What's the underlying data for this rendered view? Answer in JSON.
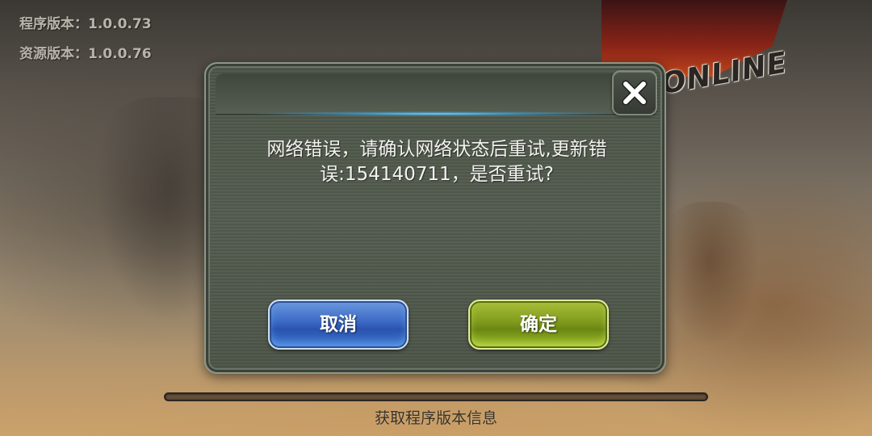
{
  "version_info": {
    "program_version": "程序版本：1.0.0.73",
    "resource_version": "资源版本：1.0.0.76"
  },
  "background": {
    "logo_text": "ONLINE"
  },
  "dialog": {
    "message": "网络错误，请确认网络状态后重试,更新错误:154140711，是否重试?",
    "close_icon": "close-icon",
    "cancel_label": "取消",
    "confirm_label": "确定",
    "colors": {
      "cancel_button": "#3a68c4",
      "confirm_button": "#7f9a1c",
      "panel": "#4f574b",
      "header_glow": "#5cc4f0"
    }
  },
  "loading": {
    "progress_fraction": 0,
    "status_text": "获取程序版本信息"
  }
}
